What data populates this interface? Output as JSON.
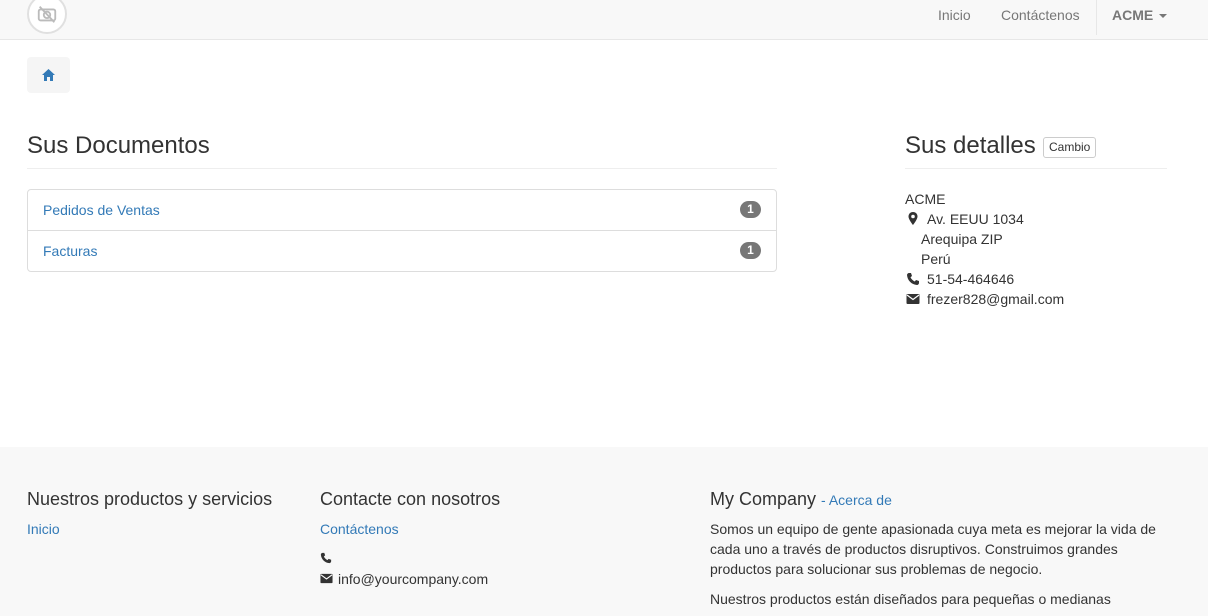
{
  "navbar": {
    "home": "Inicio",
    "contact": "Contáctenos",
    "user": "ACME"
  },
  "docs": {
    "title": "Sus Documentos",
    "items": [
      {
        "label": "Pedidos de Ventas",
        "count": "1"
      },
      {
        "label": "Facturas",
        "count": "1"
      }
    ]
  },
  "details": {
    "title": "Sus detalles",
    "change": "Cambio",
    "name": "ACME",
    "street": "Av. EEUU 1034",
    "city": "Arequipa ZIP",
    "country": "Perú",
    "phone": "51-54-464646",
    "email": "frezer828@gmail.com"
  },
  "footer": {
    "products_title": "Nuestros productos y servicios",
    "products_link": "Inicio",
    "contact_title": "Contacte con nosotros",
    "contact_link": "Contáctenos",
    "contact_phone": "",
    "contact_email": "info@yourcompany.com",
    "company_title": "My Company",
    "company_about": "- Acerca de",
    "company_text_1": "Somos un equipo de gente apasionada cuya meta es mejorar la vida de cada uno a través de productos disruptivos. Construimos grandes productos para solucionar sus problemas de negocio.",
    "company_text_2": "Nuestros productos están diseñados para pequeñas o medianas"
  },
  "icons": {
    "logo": "camera-slash-icon",
    "home": "home-icon",
    "location": "map-marker-icon",
    "phone": "phone-icon",
    "email": "envelope-icon"
  }
}
